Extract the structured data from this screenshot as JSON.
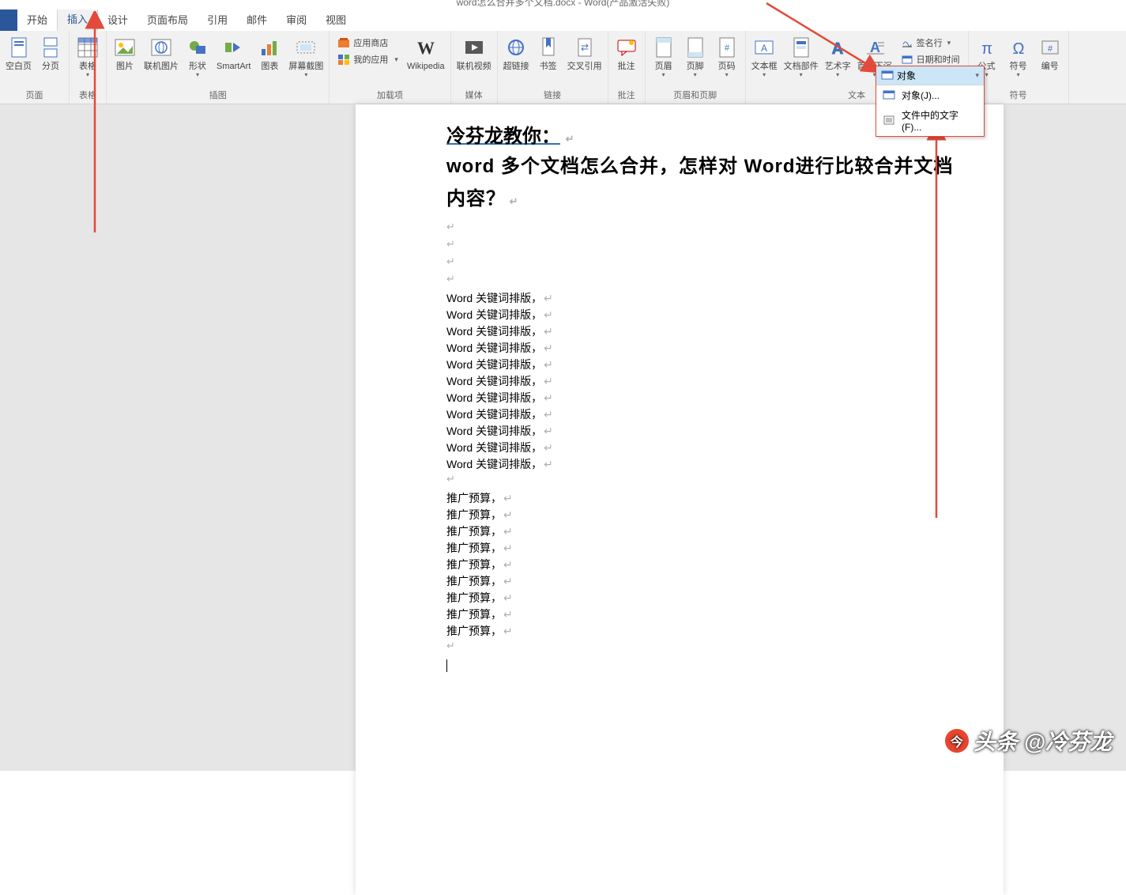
{
  "window": {
    "title": "word怎么合并多个文档.docx - Word(产品激活失败)"
  },
  "tabs": {
    "items": [
      "开始",
      "插入",
      "设计",
      "页面布局",
      "引用",
      "邮件",
      "审阅",
      "视图"
    ],
    "active_index": 1
  },
  "ribbon": {
    "groups": {
      "page": {
        "title": "页面",
        "buttons": [
          "空白页",
          "分页"
        ]
      },
      "table": {
        "title": "表格",
        "buttons": [
          "表格"
        ]
      },
      "illus": {
        "title": "插图",
        "buttons": [
          "图片",
          "联机图片",
          "形状",
          "SmartArt",
          "图表",
          "屏幕截图"
        ]
      },
      "addin": {
        "title": "加载项",
        "buttons": [
          "应用商店",
          "我的应用",
          "Wikipedia"
        ]
      },
      "media": {
        "title": "媒体",
        "buttons": [
          "联机视频"
        ]
      },
      "link": {
        "title": "链接",
        "buttons": [
          "超链接",
          "书签",
          "交叉引用"
        ]
      },
      "comment": {
        "title": "批注",
        "buttons": [
          "批注"
        ]
      },
      "hf": {
        "title": "页眉和页脚",
        "buttons": [
          "页眉",
          "页脚",
          "页码"
        ]
      },
      "text": {
        "title": "文本",
        "buttons": [
          "文本框",
          "文档部件",
          "艺术字",
          "首字下沉"
        ],
        "stack": [
          "签名行",
          "日期和时间",
          "对象"
        ]
      },
      "symbol": {
        "title": "符号",
        "buttons": [
          "公式",
          "符号",
          "编号"
        ]
      }
    }
  },
  "dropdown": {
    "header": "对象",
    "items": [
      "对象(J)...",
      "文件中的文字(F)..."
    ]
  },
  "document": {
    "title_prefix": "冷芬龙教你：",
    "heading": "word 多个文档怎么合并，怎样对 Word进行比较合并文档内容？",
    "repeat_line_1": "Word 关键词排版，",
    "repeat_count_1": 11,
    "repeat_line_2": "推广预算，",
    "repeat_count_2": 9
  },
  "watermark": {
    "text": "头条 @冷芬龙",
    "logo": "今"
  }
}
